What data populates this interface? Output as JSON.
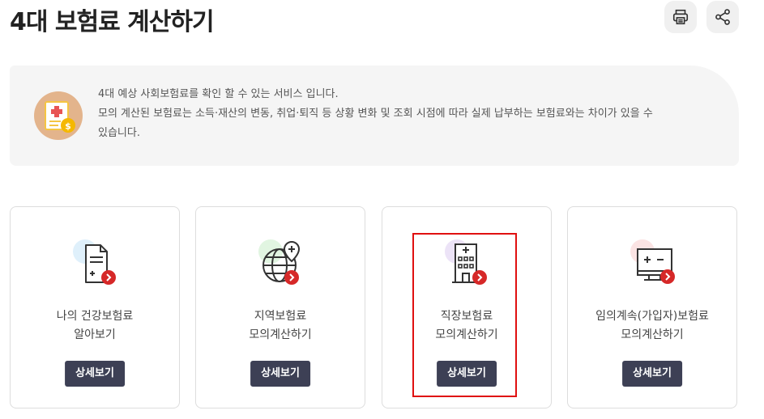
{
  "page": {
    "title": "4대 보험료 계산하기",
    "print_icon": "printer-icon",
    "share_icon": "share-icon"
  },
  "notice": {
    "icon": "insurance-document-coin-icon",
    "line1": "4대 예상 사회보험료를 확인 할 수 있는 서비스 입니다.",
    "line2": "모의 계산된 보험료는 소득·재산의 변동, 취업·퇴직 등 상황 변화 및 조회 시점에 따라 실제 납부하는 보험료와는 차이가 있을 수",
    "line3": "있습니다."
  },
  "cards": [
    {
      "icon": "document-icon",
      "line1": "나의 건강보험료",
      "line2": "알아보기",
      "button": "상세보기",
      "accent": "#dff0fb"
    },
    {
      "icon": "globe-icon",
      "line1": "지역보험료",
      "line2": "모의계산하기",
      "button": "상세보기",
      "accent": "#e1f5e1"
    },
    {
      "icon": "building-icon",
      "line1": "직장보험료",
      "line2": "모의계산하기",
      "button": "상세보기",
      "accent": "#ece3f7"
    },
    {
      "icon": "calculator-monitor-icon",
      "line1": "임의계속(가입자)보험료",
      "line2": "모의계산하기",
      "button": "상세보기",
      "accent": "#fbe3e3"
    }
  ],
  "colors": {
    "button_bg": "#3d4055",
    "badge_red": "#d62828",
    "highlight_border": "#e01010"
  }
}
